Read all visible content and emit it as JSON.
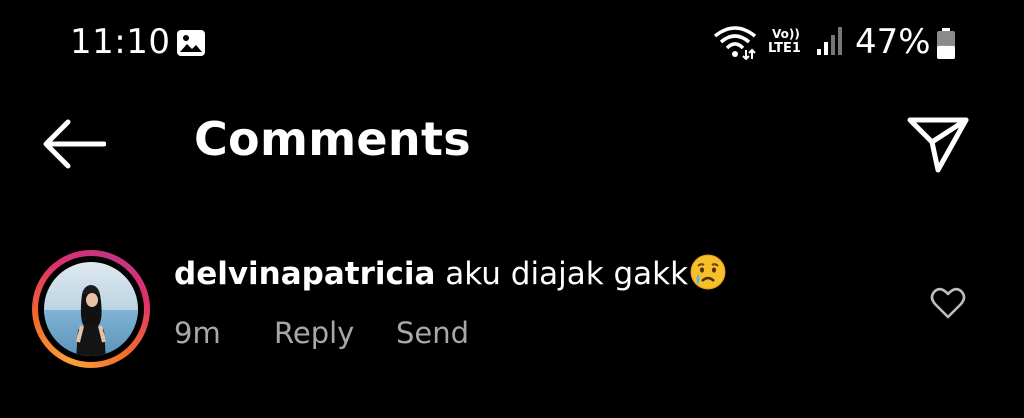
{
  "status_bar": {
    "time": "11:10",
    "gallery_icon": "image-notification-icon",
    "wifi_icon": "wifi-icon",
    "volte_top": "Vo))",
    "volte_bottom": "LTE1",
    "signal_icon": "cell-signal-icon",
    "battery_percent": "47%",
    "battery_level": 0.47
  },
  "header": {
    "back_icon": "arrow-left-icon",
    "title": "Comments",
    "share_icon": "paper-plane-icon"
  },
  "comments": [
    {
      "username": "delvinapatricia",
      "text": "aku diajak gakk",
      "emoji": "crying-face-emoji",
      "age": "9m",
      "reply_label": "Reply",
      "send_label": "Send",
      "like_icon": "heart-outline-icon",
      "story_ring_colors": [
        "#f9a13a",
        "#e1306c",
        "#c13584"
      ]
    }
  ],
  "colors": {
    "background": "#000000",
    "text": "#ffffff",
    "secondary_text": "#a8a8a8"
  }
}
